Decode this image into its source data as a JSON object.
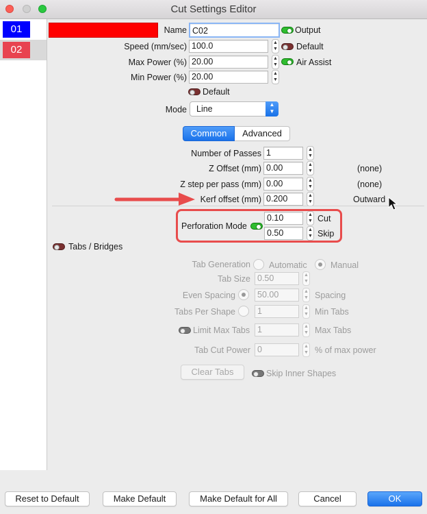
{
  "window": {
    "title": "Cut Settings Editor"
  },
  "colors": {
    "layer1": "#0000ff",
    "layer2": "#e8434f",
    "swatch": "#ff0000",
    "accent": "#1a72ea",
    "annotation": "#e84c4c"
  },
  "layers": [
    {
      "label": "01"
    },
    {
      "label": "02"
    }
  ],
  "basic": {
    "name_label": "Name",
    "name_value": "C02",
    "output_label": "Output",
    "speed_label": "Speed (mm/sec)",
    "speed_value": "100.0",
    "default_label": "Default",
    "maxpower_label": "Max Power (%)",
    "maxpower_value": "20.00",
    "airassist_label": "Air Assist",
    "minpower_label": "Min Power (%)",
    "minpower_value": "20.00",
    "default2_label": "Default",
    "mode_label": "Mode",
    "mode_value": "Line"
  },
  "tabs": {
    "common": "Common",
    "advanced": "Advanced"
  },
  "common": {
    "passes_label": "Number of Passes",
    "passes_value": "1",
    "zoffset_label": "Z Offset (mm)",
    "zoffset_value": "0.00",
    "zoffset_note": "(none)",
    "zstep_label": "Z step per pass (mm)",
    "zstep_value": "0.00",
    "zstep_note": "(none)",
    "kerf_label": "Kerf offset (mm)",
    "kerf_value": "0.200",
    "kerf_note": "Outward",
    "perf_label": "Perforation Mode",
    "perf_cut_value": "0.10",
    "perf_cut_label": "Cut",
    "perf_skip_value": "0.50",
    "perf_skip_label": "Skip"
  },
  "tabs_bridges": {
    "label": "Tabs / Bridges",
    "generation_label": "Tab Generation",
    "automatic": "Automatic",
    "manual": "Manual",
    "size_label": "Tab Size",
    "size_value": "0.50",
    "even_label": "Even Spacing",
    "even_value": "50.00",
    "spacing_label": "Spacing",
    "per_shape_label": "Tabs Per Shape",
    "per_shape_value": "1",
    "min_tabs_label": "Min Tabs",
    "limit_label": "Limit Max Tabs",
    "limit_value": "1",
    "max_tabs_label": "Max Tabs",
    "cut_power_label": "Tab Cut Power",
    "cut_power_value": "0",
    "cut_power_unit": "% of max power",
    "clear_button": "Clear Tabs",
    "skip_inner": "Skip Inner Shapes"
  },
  "buttons": {
    "reset": "Reset to Default",
    "make_default": "Make Default",
    "make_default_all": "Make Default for All",
    "cancel": "Cancel",
    "ok": "OK"
  }
}
